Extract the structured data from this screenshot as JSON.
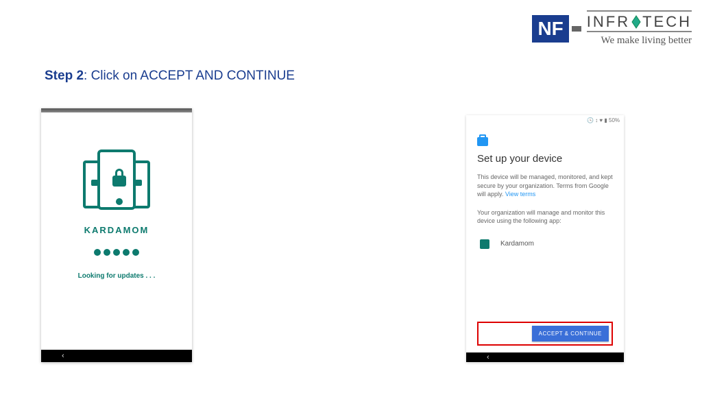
{
  "logo": {
    "nf": "NF",
    "brand_left": "INFR",
    "brand_right": "TECH",
    "tagline": "We make living better"
  },
  "step": {
    "bold": "Step 2",
    "rest": ": Click on ACCEPT AND CONTINUE"
  },
  "left_phone": {
    "title": "KARDAMOM",
    "status": "Looking for updates . . .",
    "nav_back": "‹"
  },
  "right_phone": {
    "status_bar": "🕓 ↕ ♥ ▮ 50%",
    "title": "Set up your device",
    "para1": "This device will be managed, monitored, and kept secure by your organization. Terms from Google will apply. ",
    "view_terms": "View terms",
    "para2": "Your organization will manage and monitor this device using the following app:",
    "app_name": "Kardamom",
    "accept_label": "ACCEPT & CONTINUE",
    "nav_back": "‹"
  }
}
